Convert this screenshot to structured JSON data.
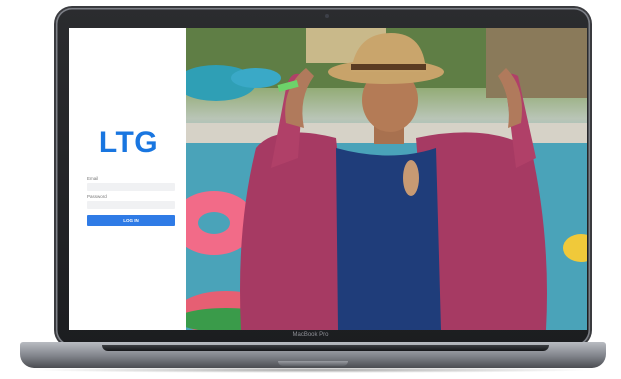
{
  "device": {
    "brand_label": "MacBook Pro"
  },
  "login": {
    "logo_text": "LTG",
    "email_label": "Email",
    "email_value": "",
    "password_label": "Password",
    "password_value": "",
    "submit_label": "LOG IN",
    "accent_color": "#1976e0"
  },
  "hero": {
    "icons": [
      "woman-photo",
      "pool-floats"
    ]
  }
}
